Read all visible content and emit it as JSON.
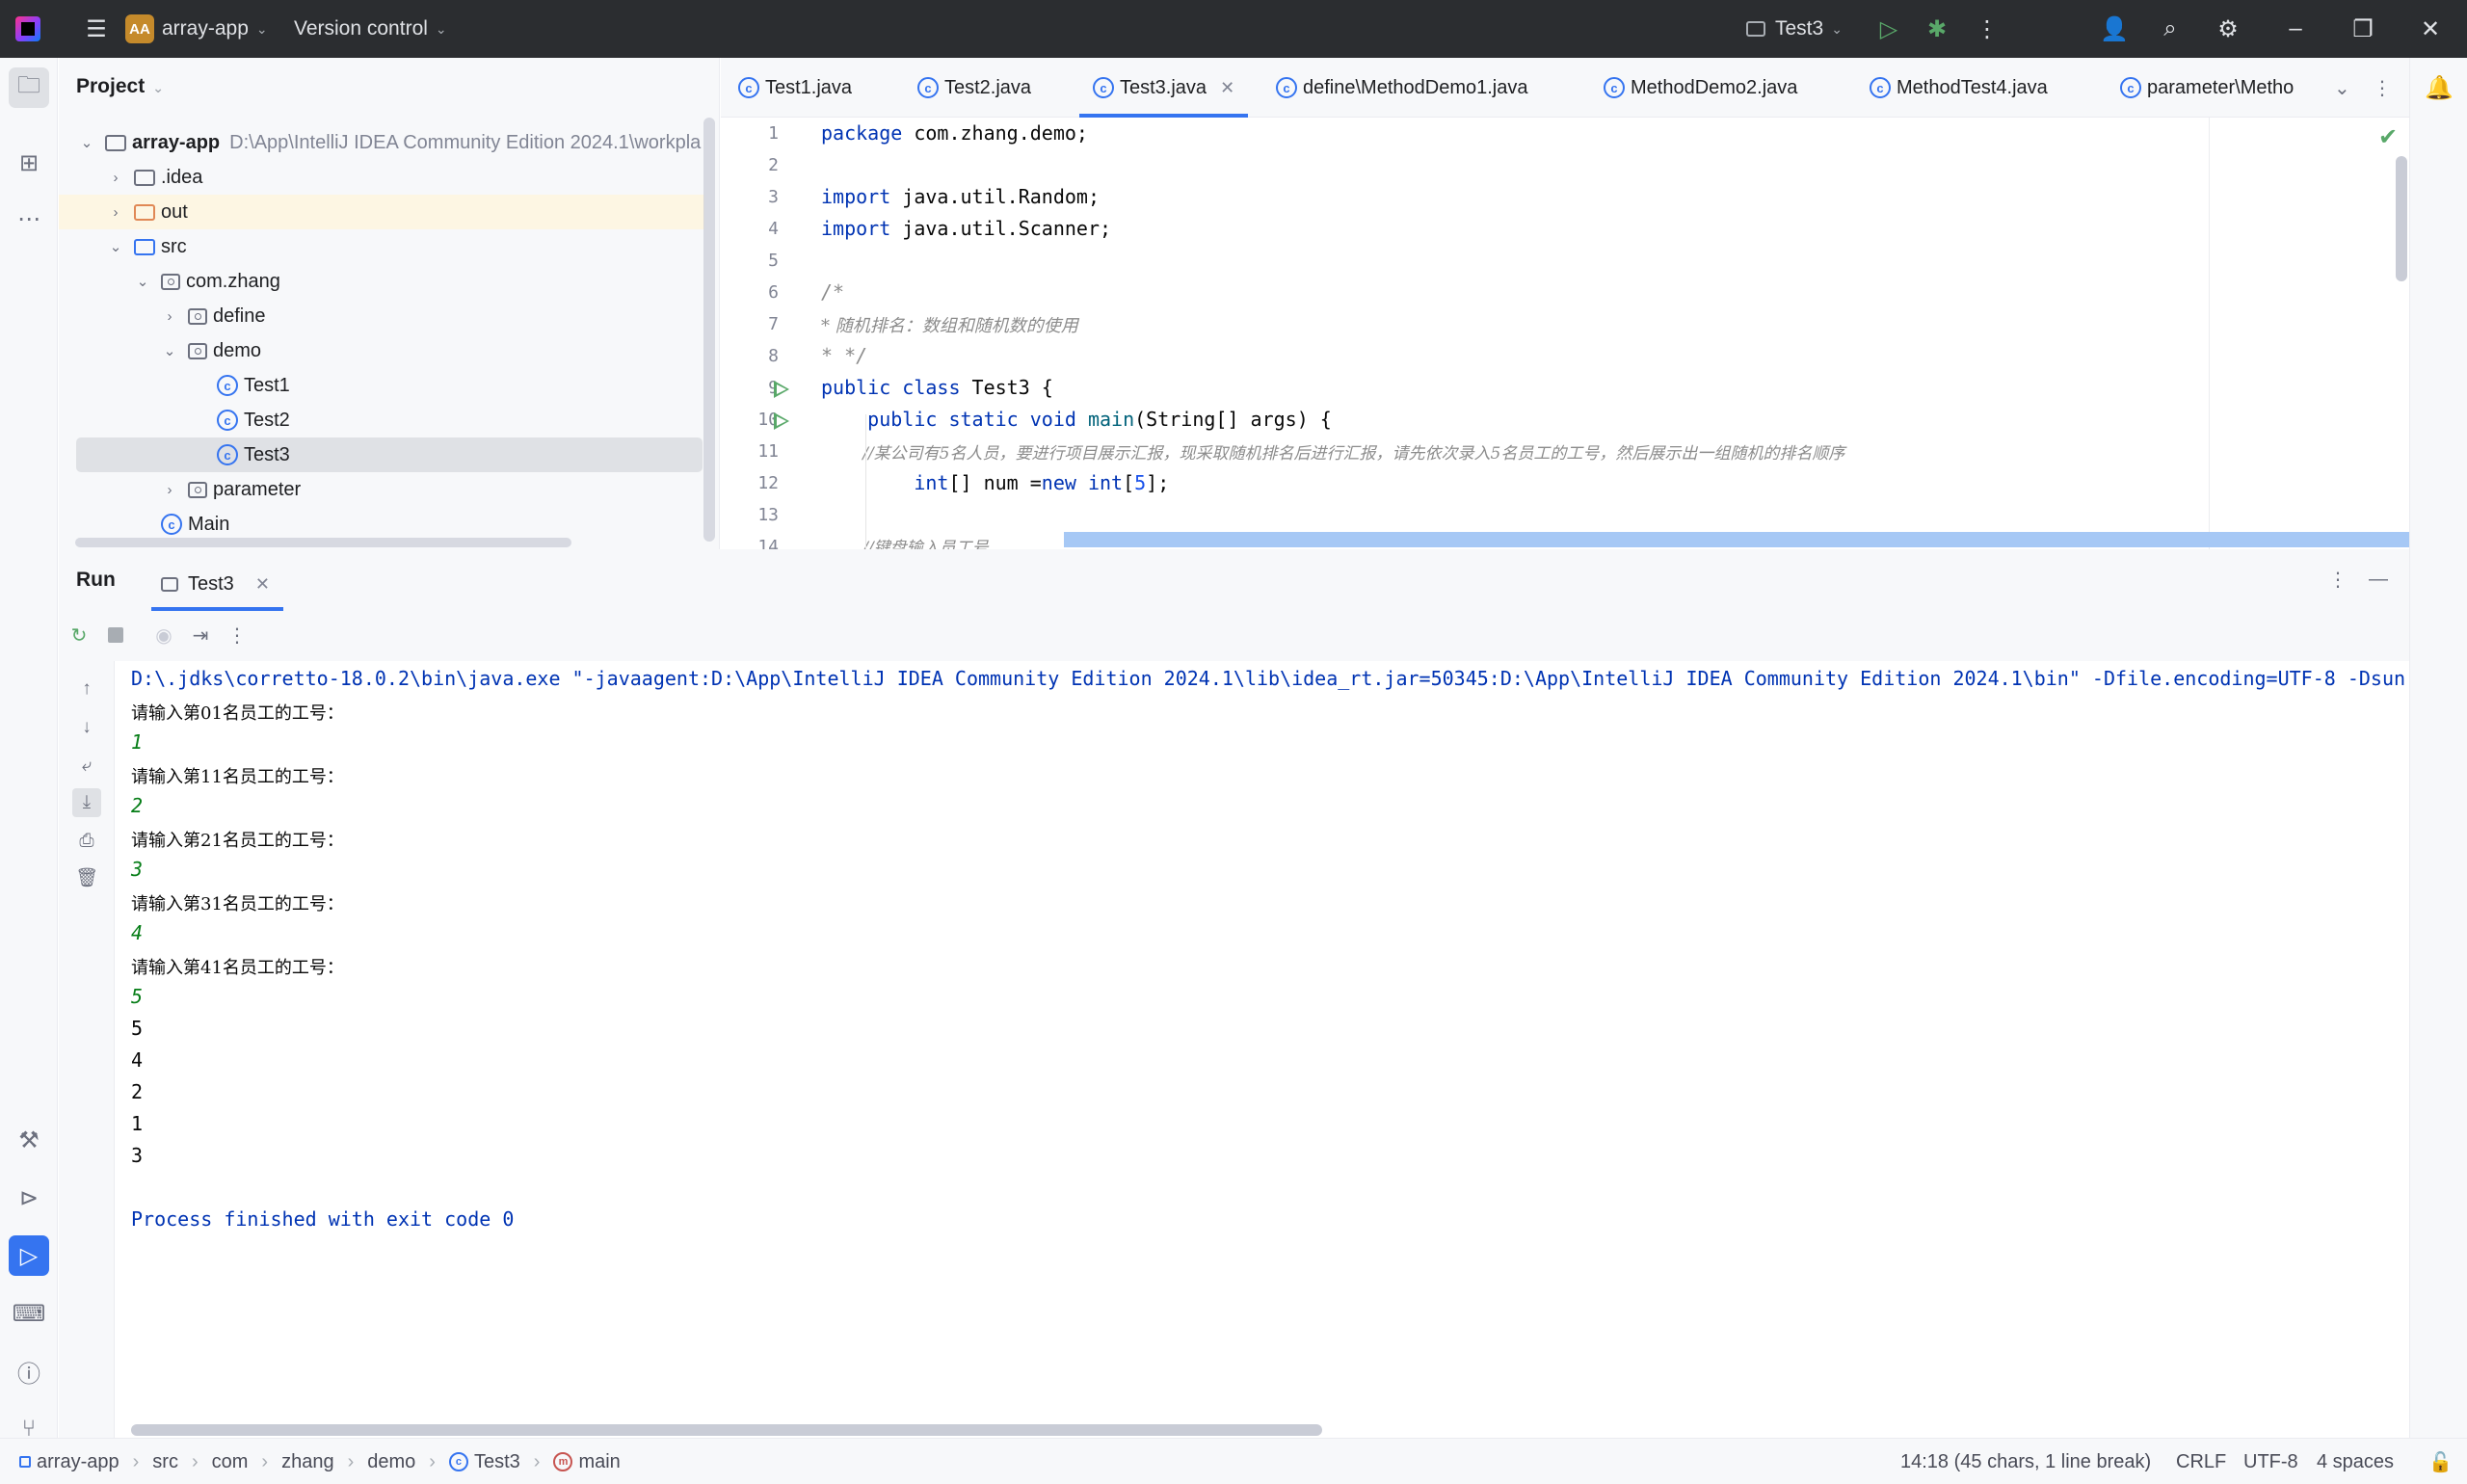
{
  "titlebar": {
    "project_badge": "AA",
    "project_name": "array-app",
    "version_control": "Version control",
    "run_config": "Test3"
  },
  "project_panel": {
    "title": "Project",
    "tree": [
      {
        "label": "array-app",
        "path": "D:\\App\\IntelliJ IDEA Community Edition 2024.1\\workpla",
        "kind": "module"
      },
      {
        "label": ".idea",
        "kind": "folder"
      },
      {
        "label": "out",
        "kind": "folder-excluded"
      },
      {
        "label": "src",
        "kind": "folder"
      },
      {
        "label": "com.zhang",
        "kind": "package"
      },
      {
        "label": "define",
        "kind": "package"
      },
      {
        "label": "demo",
        "kind": "package"
      },
      {
        "label": "Test1",
        "kind": "class"
      },
      {
        "label": "Test2",
        "kind": "class"
      },
      {
        "label": "Test3",
        "kind": "class"
      },
      {
        "label": "parameter",
        "kind": "package"
      },
      {
        "label": "Main",
        "kind": "class"
      }
    ]
  },
  "tabs": [
    {
      "label": "Test1.java"
    },
    {
      "label": "Test2.java"
    },
    {
      "label": "Test3.java"
    },
    {
      "label": "define\\MethodDemo1.java"
    },
    {
      "label": "MethodDemo2.java"
    },
    {
      "label": "MethodTest4.java"
    },
    {
      "label": "parameter\\Metho"
    }
  ],
  "editor": {
    "line_numbers": [
      "1",
      "2",
      "3",
      "4",
      "5",
      "6",
      "7",
      "8",
      "9",
      "10",
      "11",
      "12",
      "13",
      "14"
    ],
    "lines": {
      "l1_kw": "package",
      "l1_rest": " com.zhang.demo;",
      "l3_kw": "import",
      "l3_rest": " java.util.Random;",
      "l4_kw": "import",
      "l4_rest": " java.util.Scanner;",
      "l6": "/*",
      "l7": "* 随机排名：数组和随机数的使用",
      "l8": "* */",
      "l9_kw": "public class",
      "l9_rest": " Test3 {",
      "l10_kw": "    public static void",
      "l10_fn": " main",
      "l10_rest": "(String[] args) {",
      "l11": "        //某公司有5名人员，要进行项目展示汇报，现采取随机排名后进行汇报，请先依次录入5名员工的工号，然后展示出一组随机的排名顺序",
      "l12_kw1": "        int",
      "l12_mid": "[] num =",
      "l12_kw2": "new int",
      "l12_open": "[",
      "l12_num": "5",
      "l12_close": "];",
      "l14": "        //键盘输入员工号"
    }
  },
  "run": {
    "title": "Run",
    "tab_label": "Test3",
    "console": {
      "command": "D:\\.jdks\\corretto-18.0.2\\bin\\java.exe \"-javaagent:D:\\App\\IntelliJ IDEA Community Edition 2024.1\\lib\\idea_rt.jar=50345:D:\\App\\IntelliJ IDEA Community Edition 2024.1\\bin\" -Dfile.encoding=UTF-8 -Dsun.",
      "prompts": [
        "请输入第01名员工的工号：",
        "请输入第11名员工的工号：",
        "请输入第21名员工的工号：",
        "请输入第31名员工的工号：",
        "请输入第41名员工的工号："
      ],
      "inputs": [
        "1",
        "2",
        "3",
        "4",
        "5"
      ],
      "outputs": [
        "5",
        "4",
        "2",
        "1",
        "3"
      ],
      "finished": "Process finished with exit code 0"
    }
  },
  "statusbar": {
    "breadcrumbs": [
      "array-app",
      "src",
      "com",
      "zhang",
      "demo",
      "Test3",
      "main"
    ],
    "position": "14:18 (45 chars, 1 line break)",
    "line_separator": "CRLF",
    "encoding": "UTF-8",
    "indent": "4 spaces"
  },
  "colors": {
    "accent": "#3574f0",
    "run_green": "#59a869",
    "keyword": "#0033b3",
    "comment": "#8c8c8c",
    "console_input": "#067d17"
  }
}
